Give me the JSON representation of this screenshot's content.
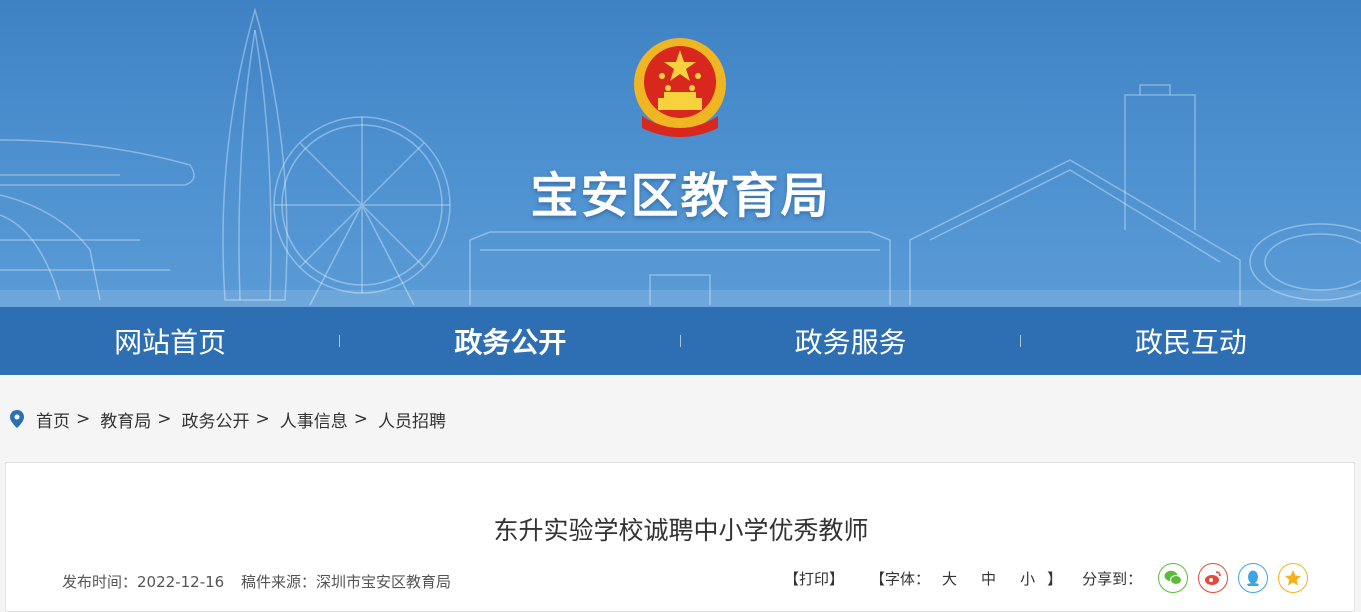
{
  "header": {
    "site_title": "宝安区教育局"
  },
  "nav": {
    "items": [
      "网站首页",
      "政务公开",
      "政务服务",
      "政民互动"
    ],
    "active_index": 1
  },
  "breadcrumb": {
    "items": [
      "首页",
      "教育局",
      "政务公开",
      "人事信息",
      "人员招聘"
    ],
    "separator": ">"
  },
  "article": {
    "title": "东升实验学校诚聘中小学优秀教师",
    "publish_label": "发布时间：",
    "publish_date": "2022-12-16",
    "source_label": "稿件来源：",
    "source": "深圳市宝安区教育局"
  },
  "tools": {
    "print": "【打印】",
    "font_prefix": "【字体：",
    "font_large": "大",
    "font_medium": "中",
    "font_small": "小",
    "font_suffix": "】",
    "share_label": "分享到：",
    "share_icons": [
      "wechat-icon",
      "weibo-icon",
      "qq-icon",
      "qzone-icon"
    ]
  },
  "colors": {
    "banner": "#4b8fcf",
    "nav": "#2e6fb3",
    "wechat": "#5cbb3b",
    "weibo": "#e6493a",
    "qq": "#3fa4e3",
    "qzone": "#f5b21a"
  }
}
